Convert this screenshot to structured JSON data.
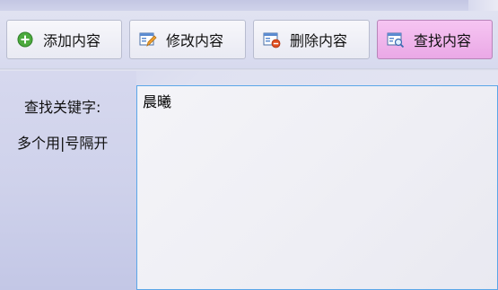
{
  "toolbar": {
    "buttons": [
      {
        "label": "添加内容",
        "icon": "plus-circle-icon"
      },
      {
        "label": "修改内容",
        "icon": "edit-form-icon"
      },
      {
        "label": "删除内容",
        "icon": "delete-form-icon"
      },
      {
        "label": "查找内容",
        "icon": "search-form-icon",
        "active": true
      }
    ]
  },
  "form": {
    "search_label": "查找关键字:",
    "hint_label": "多个用|号隔开",
    "keyword_value": "晨曦"
  },
  "colors": {
    "active_button": "#eaa8e6",
    "textarea_border": "#5aa6e8"
  }
}
